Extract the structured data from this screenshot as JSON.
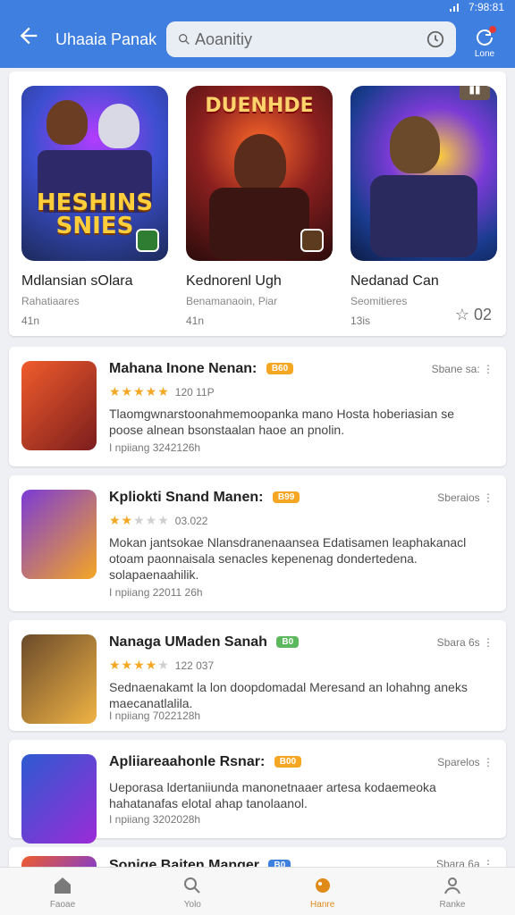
{
  "status": {
    "time": "7:98:81"
  },
  "app": {
    "title": "Uhaaia Panak",
    "search_text": "Aoanitiy",
    "done_label": "Lone"
  },
  "featured": [
    {
      "name": "Mdlansian sOlara",
      "sub": "Rahatiaares",
      "meta": "41n",
      "thumb_title": "HESHINS SNIES"
    },
    {
      "name": "Kednorenl Ugh",
      "sub": "Benamanaoin, Piar",
      "meta": "41n",
      "thumb_title": "DUENHDE"
    },
    {
      "name": "Nedanad Can",
      "sub": "Seomitieres",
      "meta": "13is",
      "extra": "02"
    }
  ],
  "list": [
    {
      "title": "Mahana Inone Nenan:",
      "badge": "B60",
      "right": "Sbane sa:",
      "rating_text": "120 11P",
      "stars": 5,
      "desc": "Tlaomgwnarstoonahmemoopanka mano Hosta hoberiasian se poose alnean bsonstaalan haoe an pnolin.",
      "foot": "I npiiang 3242126h"
    },
    {
      "title": "Kpliokti Snand Manen:",
      "badge": "B99",
      "right": "Sberaios",
      "rating_text": "03.022",
      "stars": 2,
      "desc": "Mokan jantsokae Nlansdranenaansea Edatisamen leaphakanacl otoam paonnaisala senacles kepenenag dondertedena. solapaenaahilik.",
      "foot": "I npiiang 22011 26h"
    },
    {
      "title": "Nanaga UMaden Sanah",
      "badge": "B0",
      "right": "Sbara 6s",
      "rating_text": "122 037",
      "stars": 4,
      "desc": "Sednaenakamt la lon doopdomadal Meresand an lohahng aneks maecanatlalila.",
      "foot": "I npiiang 7022128h"
    },
    {
      "title": "Apliiareaahonle Rsnar:",
      "badge": "B00",
      "right": "Sparelos",
      "rating_text": "",
      "stars": 0,
      "desc": "Ueporasa ldertaniiunda manonetnaaer artesa kodaemeoka hahatanafas elotal ahap tanolaanol.",
      "foot": "I npiiang 3202028h"
    },
    {
      "title": "Sonige Baiten Manger",
      "badge": "B0",
      "right": "Sbara 6a",
      "rating_text": "",
      "stars": 0,
      "desc": "",
      "foot": ""
    }
  ],
  "bottomnav": [
    {
      "label": "Faoae"
    },
    {
      "label": "Yolo"
    },
    {
      "label": "Hanre"
    },
    {
      "label": "Ranke"
    }
  ],
  "colors": {
    "accent": "#3f7fe0",
    "active_nav": "#e08a19"
  }
}
